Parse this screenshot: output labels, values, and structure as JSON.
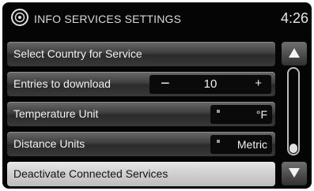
{
  "header": {
    "title": "INFO SERVICES SETTINGS",
    "clock": "4:26",
    "icon": "settings-dial-icon"
  },
  "menu": {
    "items": [
      {
        "label": "Select Country for Service"
      },
      {
        "label": "Entries to download",
        "value": "10",
        "decrement": "−",
        "increment": "+"
      },
      {
        "label": "Temperature Unit",
        "value": "°F"
      },
      {
        "label": "Distance Units",
        "value": "Metric"
      },
      {
        "label": "Deactivate Connected Services"
      }
    ]
  },
  "scroll": {
    "up_icon": "arrow-up-icon",
    "down_icon": "arrow-down-icon",
    "position": 1.0
  },
  "colors": {
    "selected_row": "#cfcfcf",
    "screen_bg": "#050505"
  }
}
